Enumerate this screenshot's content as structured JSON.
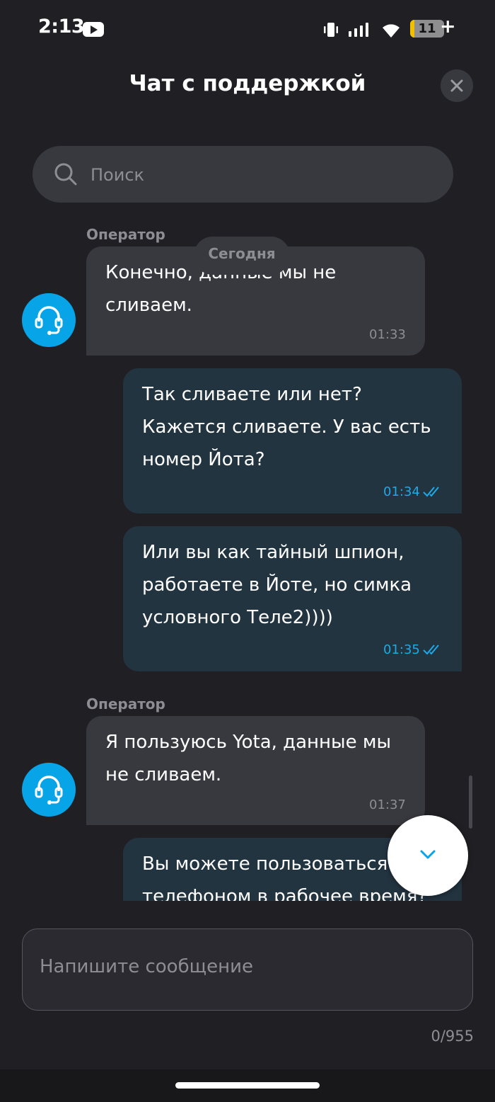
{
  "status_bar": {
    "time": "2:13",
    "battery": "11"
  },
  "header": {
    "title": "Чат с поддержкой"
  },
  "search": {
    "placeholder": "Поиск"
  },
  "chat": {
    "date_separator": "Сегодня",
    "messages": [
      {
        "direction": "in",
        "sender": "Оператор",
        "lines": [
          "Конечно, данные мы не",
          "сливаем."
        ],
        "time": "01:33"
      },
      {
        "direction": "out",
        "lines": [
          "Так сливаете или нет?",
          "Кажется сливаете. У вас есть",
          "номер Йота?"
        ],
        "time": "01:34",
        "status": "read"
      },
      {
        "direction": "out",
        "lines": [
          "Или вы как тайный шпион,",
          "работаете в Йоте, но симка",
          "условного Теле2))))"
        ],
        "time": "01:35",
        "status": "read"
      },
      {
        "direction": "in",
        "sender": "Оператор",
        "lines": [
          "Я пользуюсь Yota, данные мы",
          "не сливаем."
        ],
        "time": "01:37"
      },
      {
        "direction": "out",
        "lines": [
          "Вы можете пользоваться",
          "телефоном в рабочее время?"
        ]
      }
    ]
  },
  "composer": {
    "placeholder": "Напишите сообщение",
    "counter": "0/955"
  },
  "colors": {
    "accent": "#08a4e8",
    "incoming_bubble": "#38383f",
    "outgoing_bubble": "#233441",
    "background": "#202024"
  }
}
